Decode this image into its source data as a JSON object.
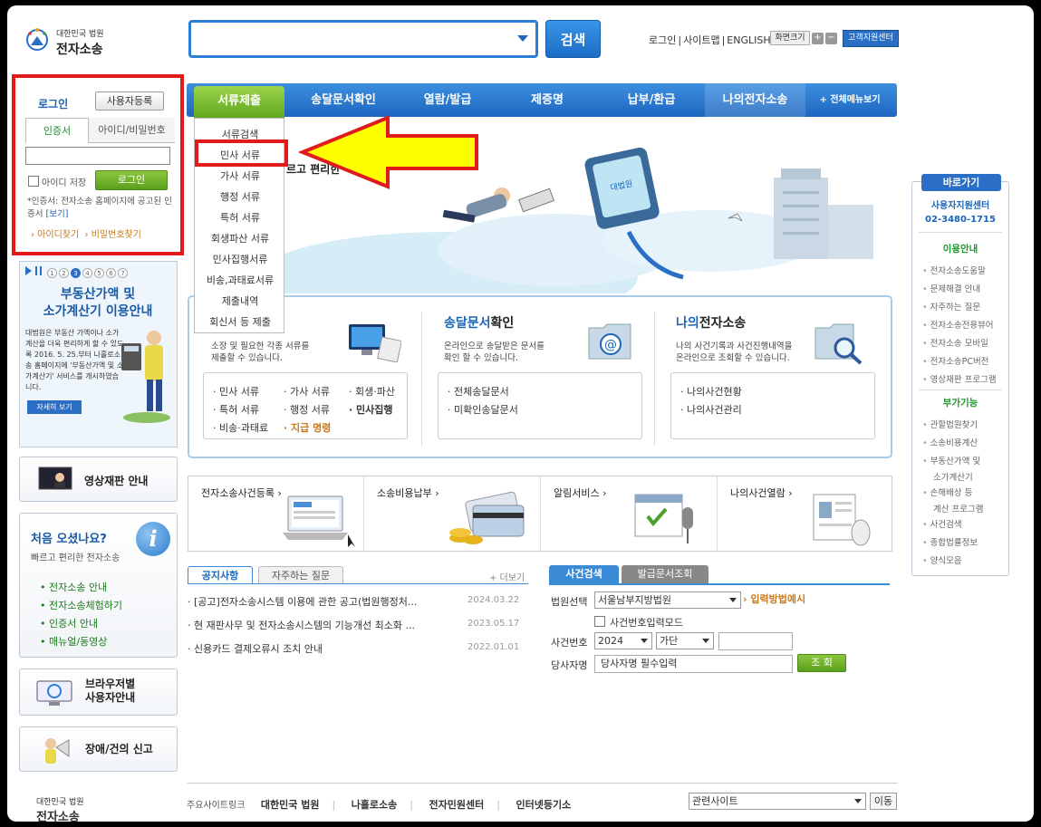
{
  "header": {
    "logo_top": "대한민국 법원",
    "logo_main": "전자소송",
    "search_button": "검색",
    "links": [
      "로그인",
      "사이트맵",
      "ENGLISH"
    ],
    "font_size_label": "화면크기",
    "font_plus": "+",
    "font_minus": "−",
    "support_center": "고객지원센터"
  },
  "login": {
    "tab_label": "로그인",
    "register_button": "사용자등록",
    "subtab_cert": "인증서",
    "subtab_id": "아이디/비밀번호",
    "save_id": "아이디 저장",
    "login_button": "로그인",
    "note_text": "*인증서: 전자소송 홈페이지에 공고된 인증서",
    "note_link": "[보기]",
    "find_id": "› 아이디찾기",
    "find_pw": "› 비밀번호찾기"
  },
  "banner": {
    "pages": [
      "1",
      "2",
      "3",
      "4",
      "5",
      "6",
      "7"
    ],
    "active_page": 3,
    "title_line1": "부동산가액 및",
    "title_line2": "소가계산기 이용안내",
    "text": "대법원은 부동산 가액이나 소가 계산을 더욱 편리하게 할 수 있도록 2016. 5. 25.부터 나홀로소송 홈페이지에 '부동산가액 및 소가계산기' 서비스를 개시하였습니다.",
    "more_button": "자세히 보기"
  },
  "sidebar": {
    "video_trial": "영상재판 안내",
    "first_title": "처음 오셨나요?",
    "first_sub": "빠르고 편리한 전자소송",
    "first_items": [
      "전자소송 안내",
      "전자소송체험하기",
      "인증서 안내",
      "매뉴얼/동영상"
    ],
    "browser_line1": "브라우저별",
    "browser_line2": "사용자안내",
    "report": "장애/건의 신고"
  },
  "nav": {
    "items": [
      "서류제출",
      "송달문서확인",
      "열람/발급",
      "제증명",
      "납부/환급",
      "나의전자소송"
    ],
    "all_menu": "+ 전체메뉴보기",
    "dropdown": [
      "서류검색",
      "민사 서류",
      "가사 서류",
      "행정 서류",
      "특허 서류",
      "회생파산 서류",
      "민사집행서류",
      "비송,과태료서류",
      "제출내역",
      "회신서 등 제출"
    ]
  },
  "hero": {
    "text": "르고 편리한"
  },
  "services": {
    "doc_desc1": "소장 및 필요한 각종 서류를",
    "doc_desc2": "제출할 수 있습니다.",
    "doc_items": [
      "· 민사 서류",
      "· 가사 서류",
      "· 회생·파산",
      "· 특허 서류",
      "· 행정 서류",
      "· 민사집행",
      "· 비송·과태료",
      "· 지급 명령"
    ],
    "delivery_title_a": "송달문서",
    "delivery_title_b": "확인",
    "delivery_desc1": "온라인으로 송달받은 문서를",
    "delivery_desc2": "확인 할 수 있습니다.",
    "delivery_items": [
      "· 전체송달문서",
      "· 미확인송달문서"
    ],
    "mine_title_a": "나의",
    "mine_title_b": "전자소송",
    "mine_desc1": "나의 사건기록과 사건진행내역을",
    "mine_desc2": "온라인으로 조회할 수 있습니다.",
    "mine_items": [
      "· 나의사건현황",
      "· 나의사건관리"
    ]
  },
  "quick": {
    "items": [
      "전자소송사건등록 ›",
      "소송비용납부 ›",
      "알림서비스 ›",
      "나의사건열람 ›"
    ]
  },
  "notice": {
    "tab_notice": "공지사항",
    "tab_faq": "자주하는 질문",
    "more": "+ 더보기",
    "items": [
      {
        "title": "· [공고]전자소송시스템 이용에 관한 공고(법원행정처...",
        "date": "2024.03.22"
      },
      {
        "title": "· 현 재판사무 및 전자소송시스템의 기능개선 최소화 ...",
        "date": "2023.05.17"
      },
      {
        "title": "· 신용카드 결제오류시 조치 안내",
        "date": "2022.01.01"
      }
    ]
  },
  "case_search": {
    "tab_search": "사건검색",
    "tab_docs": "발급문서조회",
    "court_label": "법원선택",
    "court_value": "서울남부지방법원",
    "howto": "› 입력방법예시",
    "direct_input": "사건번호입력모드",
    "number_label": "사건번호",
    "year_value": "2024",
    "type_value": "가단",
    "party_label": "당사자명",
    "party_placeholder": "당사자명 필수입력",
    "search_button": "조 회"
  },
  "rightbar": {
    "head": "바로가기",
    "center_name": "사용자지원센터",
    "center_phone": "02-3480-1715",
    "sec_guide": "이용안내",
    "guide_links": [
      "전자소송도움말",
      "문제해결 안내",
      "자주하는 질문",
      "전자소송전용뷰어",
      "전자소송 모바일",
      "전자소송PC버전",
      "영상재판 프로그램"
    ],
    "sec_extra": "부가기능",
    "extra_links": [
      "관할법원찾기",
      "소송비용계산",
      "부동산가액 및",
      "소가계산기",
      "손해배상 등",
      "계산 프로그램",
      "사건검색",
      "종합법률정보",
      "양식모음"
    ]
  },
  "footer": {
    "logo_top": "대한민국 법원",
    "logo_main": "전자소송",
    "label": "주요사이트링크",
    "links": [
      "대한민국 법원",
      "나홀로소송",
      "전자민원센터",
      "인터넷등기소"
    ],
    "related": "관련사이트",
    "go": "이동"
  },
  "colors": {
    "nav_blue": "#1e66c0",
    "active_green": "#5fa61f",
    "highlight_red": "#e11b1b",
    "arrow_yellow": "#ffff00"
  }
}
